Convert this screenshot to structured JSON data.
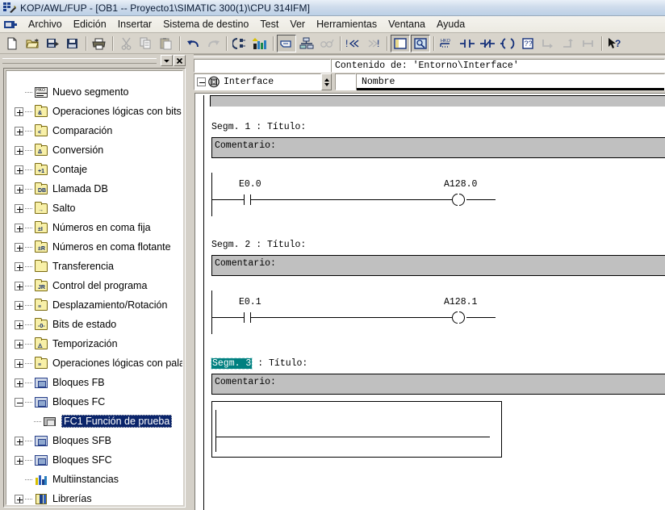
{
  "window": {
    "title": "KOP/AWL/FUP  - [OB1 -- Proyecto1\\SIMATIC 300(1)\\CPU 314IFM]",
    "icon": "simatic-app-icon"
  },
  "menubar": {
    "doc_icon": "document-window-icon",
    "items": [
      {
        "label": "Archivo"
      },
      {
        "label": "Edición"
      },
      {
        "label": "Insertar"
      },
      {
        "label": "Sistema de destino"
      },
      {
        "label": "Test"
      },
      {
        "label": "Ver"
      },
      {
        "label": "Herramientas"
      },
      {
        "label": "Ventana"
      },
      {
        "label": "Ayuda"
      }
    ]
  },
  "toolbar": {
    "buttons": [
      {
        "name": "new-file-icon",
        "tooltip": "Nuevo"
      },
      {
        "name": "open-folder-icon",
        "tooltip": "Abrir"
      },
      {
        "name": "save-as-icon",
        "tooltip": "Guardar como"
      },
      {
        "name": "save-icon",
        "tooltip": "Guardar"
      },
      {
        "name": "print-icon",
        "tooltip": "Imprimir"
      },
      {
        "name": "cut-icon",
        "tooltip": "Cortar"
      },
      {
        "name": "copy-icon",
        "tooltip": "Copiar"
      },
      {
        "name": "paste-icon",
        "tooltip": "Pegar"
      },
      {
        "name": "undo-icon",
        "tooltip": "Deshacer"
      },
      {
        "name": "redo-icon",
        "tooltip": "Rehacer"
      },
      {
        "name": "download-plc-icon",
        "tooltip": "Cargar"
      },
      {
        "name": "monitor-block-icon",
        "tooltip": "Observar/forzar"
      },
      {
        "name": "toggle-comment-icon",
        "tooltip": "Comentario"
      },
      {
        "name": "symbol-table-icon",
        "tooltip": "Tabla de símbolos"
      },
      {
        "name": "glasses-icon",
        "tooltip": "Observar"
      },
      {
        "name": "error-first-icon",
        "tooltip": "Primer error"
      },
      {
        "name": "error-prev-icon",
        "tooltip": "Error anterior"
      },
      {
        "name": "error-next-icon",
        "tooltip": "Error siguiente"
      },
      {
        "name": "overview-pane-icon",
        "tooltip": "Vista general"
      },
      {
        "name": "zoom-pane-icon",
        "tooltip": "Zoom"
      },
      {
        "name": "new-network-icon",
        "tooltip": "Nuevo segmento"
      },
      {
        "name": "contact-no-icon",
        "tooltip": "Contacto normalmente abierto"
      },
      {
        "name": "contact-nc-icon",
        "tooltip": "Contacto normalmente cerrado"
      },
      {
        "name": "coil-icon",
        "tooltip": "Bobina"
      },
      {
        "name": "empty-box-icon",
        "tooltip": "Cuadro vacío"
      },
      {
        "name": "branch-open-icon",
        "tooltip": "Abrir rama"
      },
      {
        "name": "branch-close-icon",
        "tooltip": "Cerrar rama"
      },
      {
        "name": "branch-parallel-icon",
        "tooltip": "Rama paralela"
      },
      {
        "name": "help-pointer-icon",
        "tooltip": "Ayuda contextual"
      }
    ]
  },
  "left_panel": {
    "dropdown_icon": "chevron-down-icon",
    "close_icon": "close-icon",
    "tree": [
      {
        "label": "Nuevo segmento",
        "icon": "new-network-icon",
        "expander": "none",
        "indent": 0,
        "selected": false
      },
      {
        "label": "Operaciones lógicas con bits",
        "icon": "folder-icon",
        "expander": "plus",
        "indent": 0,
        "selected": false,
        "glyph": "&amp;"
      },
      {
        "label": "Comparación",
        "icon": "folder-icon",
        "expander": "plus",
        "indent": 0,
        "selected": false,
        "glyph": "&lt;"
      },
      {
        "label": "Conversión",
        "icon": "folder-icon",
        "expander": "plus",
        "indent": 0,
        "selected": false,
        "glyph": "Δ"
      },
      {
        "label": "Contaje",
        "icon": "folder-icon",
        "expander": "plus",
        "indent": 0,
        "selected": false,
        "glyph": "+1"
      },
      {
        "label": "Llamada DB",
        "icon": "folder-icon",
        "expander": "plus",
        "indent": 0,
        "selected": false,
        "glyph": "DB"
      },
      {
        "label": "Salto",
        "icon": "folder-icon",
        "expander": "plus",
        "indent": 0,
        "selected": false,
        "glyph": "→"
      },
      {
        "label": "Números en coma fija",
        "icon": "folder-icon",
        "expander": "plus",
        "indent": 0,
        "selected": false,
        "glyph": "±I"
      },
      {
        "label": "Números en coma flotante",
        "icon": "folder-icon",
        "expander": "plus",
        "indent": 0,
        "selected": false,
        "glyph": "±R"
      },
      {
        "label": "Transferencia",
        "icon": "folder-icon",
        "expander": "plus",
        "indent": 0,
        "selected": false,
        "glyph": ""
      },
      {
        "label": "Control del programa",
        "icon": "folder-icon",
        "expander": "plus",
        "indent": 0,
        "selected": false,
        "glyph": "JR"
      },
      {
        "label": "Desplazamiento/Rotación",
        "icon": "folder-icon",
        "expander": "plus",
        "indent": 0,
        "selected": false,
        "glyph": "≡"
      },
      {
        "label": "Bits de estado",
        "icon": "folder-icon",
        "expander": "plus",
        "indent": 0,
        "selected": false,
        "glyph": "−0"
      },
      {
        "label": "Temporización",
        "icon": "folder-icon",
        "expander": "plus",
        "indent": 0,
        "selected": false,
        "glyph": "○"
      },
      {
        "label": "Operaciones lógicas con palabra",
        "icon": "folder-icon",
        "expander": "plus",
        "indent": 0,
        "selected": false,
        "glyph": "≡"
      },
      {
        "label": "Bloques FB",
        "icon": "block-icon",
        "expander": "plus",
        "indent": 0,
        "selected": false
      },
      {
        "label": "Bloques FC",
        "icon": "block-icon",
        "expander": "minus",
        "indent": 0,
        "selected": false
      },
      {
        "label": "FC1   Función de prueba",
        "icon": "fc-block-icon",
        "expander": "none",
        "indent": 1,
        "selected": true
      },
      {
        "label": "Bloques SFB",
        "icon": "block-icon",
        "expander": "plus",
        "indent": 0,
        "selected": false
      },
      {
        "label": "Bloques SFC",
        "icon": "block-icon",
        "expander": "plus",
        "indent": 0,
        "selected": false
      },
      {
        "label": "Multiinstancias",
        "icon": "multi-instance-icon",
        "expander": "none",
        "indent": 0,
        "selected": false
      },
      {
        "label": "Librerías",
        "icon": "library-icon",
        "expander": "plus",
        "indent": 0,
        "selected": false
      }
    ]
  },
  "interface_pane": {
    "content_header": "Contenido de: 'Entorno\\Interface'",
    "tree_root": "Interface",
    "tree_root_icon": "interface-node-icon",
    "tree_root_expander": "minus",
    "column_headers": [
      "",
      "Nombre"
    ],
    "rows": []
  },
  "code": {
    "segments": [
      {
        "title_prefix": "Segm.  1",
        "title_suffix": " : Título:",
        "title_selected": false,
        "comment": "Comentario:",
        "rung": {
          "type": "contact-coil",
          "contact_label": "E0.0",
          "coil_label": "A128.0"
        }
      },
      {
        "title_prefix": "Segm.  2",
        "title_suffix": " : Título:",
        "title_selected": false,
        "comment": "Comentario:",
        "rung": {
          "type": "contact-coil",
          "contact_label": "E0.1",
          "coil_label": "A128.1"
        }
      },
      {
        "title_prefix": "Segm.  3",
        "title_suffix": " : Título:",
        "title_selected": true,
        "comment": "Comentario:",
        "rung": {
          "type": "empty-box",
          "contact_label": "",
          "coil_label": ""
        }
      }
    ]
  },
  "colors": {
    "selection_blue": "#0a246a",
    "selection_teal": "#008080",
    "comment_gray": "#c0c0c0",
    "chrome_gray": "#d4d0c8",
    "titlebar_blue": "#bcd0e6"
  }
}
